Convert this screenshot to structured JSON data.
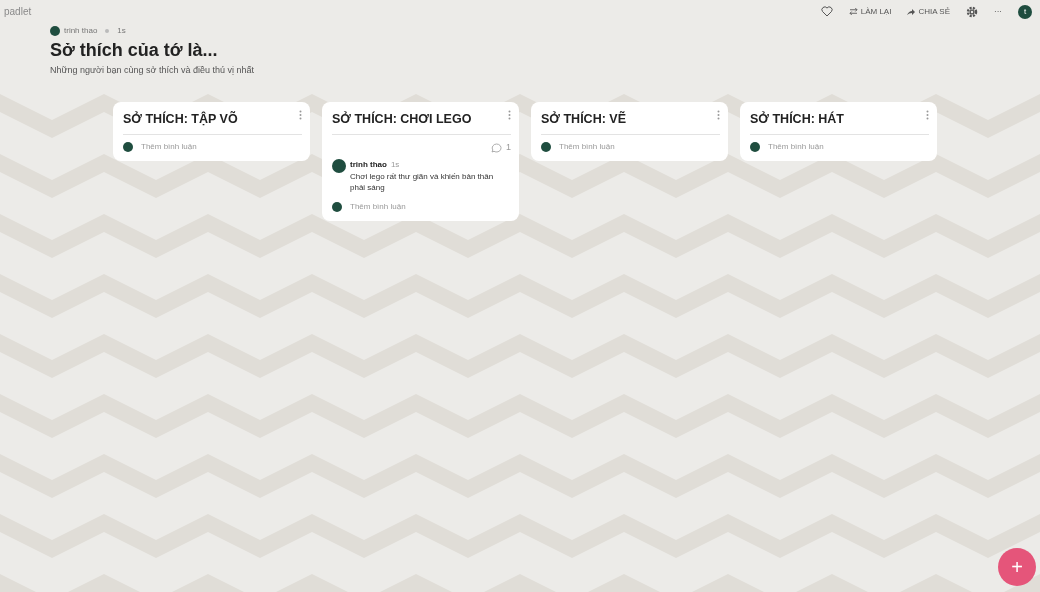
{
  "brand": "padlet",
  "toolbar": {
    "remake": "LÀM LẠI",
    "share": "CHIA SẺ",
    "more": "···",
    "avatar_letter": "t"
  },
  "header": {
    "author": "trinh thao",
    "time": "1s",
    "title": "Sở thích của tớ là...",
    "description": "Những người bạn cùng sở thích và điều thú vị nhất"
  },
  "posts": [
    {
      "title": "SỞ THÍCH: TẬP VÕ",
      "add_comment": "Thêm bình luận"
    },
    {
      "title": "SỞ THÍCH: CHƠI LEGO",
      "comment_count": "1",
      "comments": [
        {
          "author": "trinh thao",
          "time": "1s",
          "text": "Chơi lego rất thư giãn và khiến bản thân phải sáng"
        }
      ],
      "add_comment": "Thêm bình luận"
    },
    {
      "title": "SỞ THÍCH: VẼ",
      "add_comment": "Thêm bình luận"
    },
    {
      "title": "SỞ THÍCH: HÁT",
      "add_comment": "Thêm bình luận"
    }
  ],
  "fab": "+"
}
